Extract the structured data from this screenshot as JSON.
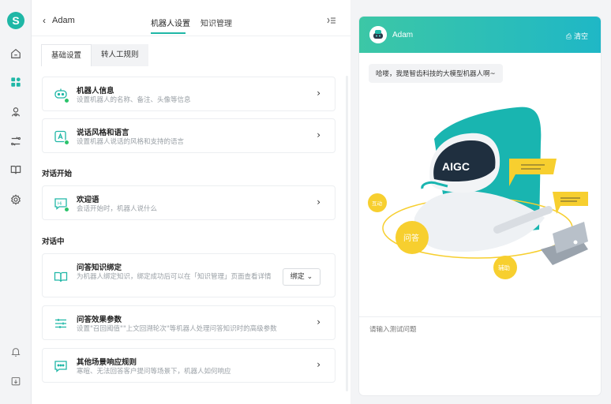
{
  "app": {
    "logo_letter": "S"
  },
  "rail": {
    "items": [
      {
        "icon": "home-icon"
      },
      {
        "icon": "apps-icon",
        "active": true
      },
      {
        "icon": "robot-person-icon"
      },
      {
        "icon": "workflow-icon"
      },
      {
        "icon": "book-icon"
      },
      {
        "icon": "settings-icon"
      }
    ],
    "bottom": [
      {
        "icon": "bell-icon"
      },
      {
        "icon": "export-icon"
      }
    ]
  },
  "header": {
    "back_label": "Adam",
    "tabs": [
      {
        "label": "机器人设置",
        "active": true
      },
      {
        "label": "知识管理",
        "active": false
      }
    ]
  },
  "subtabs": [
    {
      "label": "基础设置",
      "active": true
    },
    {
      "label": "转人工规则",
      "active": false
    }
  ],
  "sections": {
    "start": "对话开始",
    "during": "对话中"
  },
  "cards": {
    "robot_info": {
      "title": "机器人信息",
      "desc": "设置机器人的名称、备注、头像等信息"
    },
    "style": {
      "title": "说话风格和语言",
      "desc": "设置机器人说话的风格和支持的语言"
    },
    "welcome": {
      "title": "欢迎语",
      "desc": "会话开始时，机器人说什么"
    },
    "knowledge": {
      "title": "问答知识绑定",
      "desc": "为机器人绑定知识，绑定成功后可以在「知识管理」页面查看详情",
      "button": "绑定"
    },
    "params": {
      "title": "问答效果参数",
      "desc": "设置\"召回阈值\"\"上文回溯轮次\"等机器人处理问答知识时的高级参数"
    },
    "other_rules": {
      "title": "其他场景响应规则",
      "desc": "寒暄、无法回答客户提问等场景下，机器人如何响应"
    }
  },
  "chat": {
    "bot_name": "Adam",
    "clear_label": "清空",
    "greeting": "哈喽，我是智齿科技的大模型机器人啊~",
    "illustration_labels": {
      "screen": "AIGC",
      "tag_left": "互动",
      "tag_qa": "问答",
      "tag_assist": "辅助"
    },
    "input_placeholder": "请输入测试问题"
  },
  "colors": {
    "accent": "#1fb7a6",
    "badge": "#2bc36b",
    "yellow": "#f7cf2f"
  }
}
